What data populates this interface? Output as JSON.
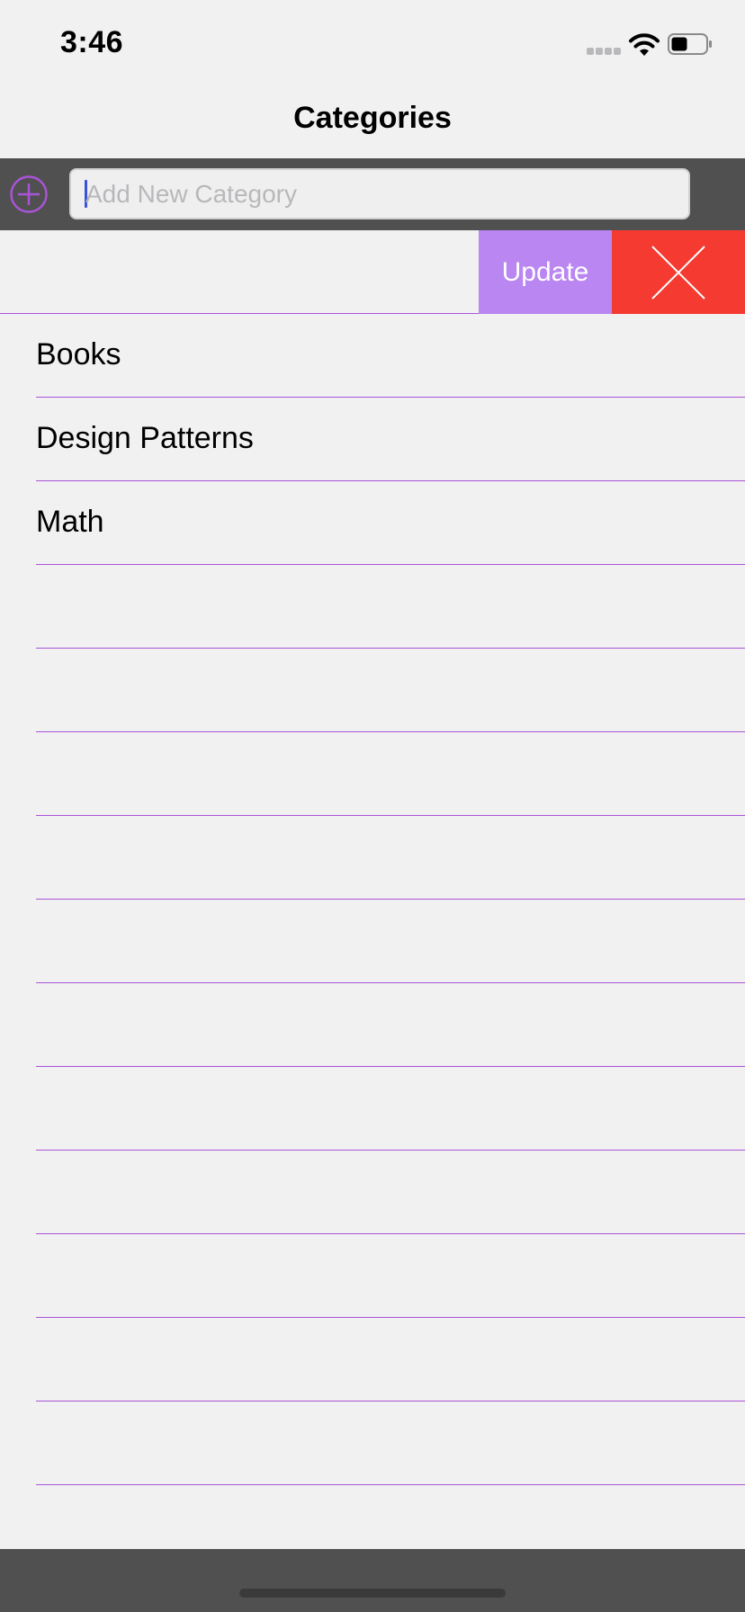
{
  "status_bar": {
    "time": "3:46"
  },
  "nav": {
    "title": "Categories"
  },
  "toolbar": {
    "input_placeholder": "Add New Category",
    "input_value": ""
  },
  "swipe_row": {
    "update_label": "Update"
  },
  "categories": [
    "Books",
    "Design Patterns",
    "Math"
  ],
  "colors": {
    "accent": "#a954d6",
    "update": "#b986f2",
    "delete": "#f43a31",
    "bar": "#505050",
    "background": "#f2f1f2"
  },
  "icons": {
    "add": "plus-circle-icon",
    "delete": "close-icon"
  }
}
